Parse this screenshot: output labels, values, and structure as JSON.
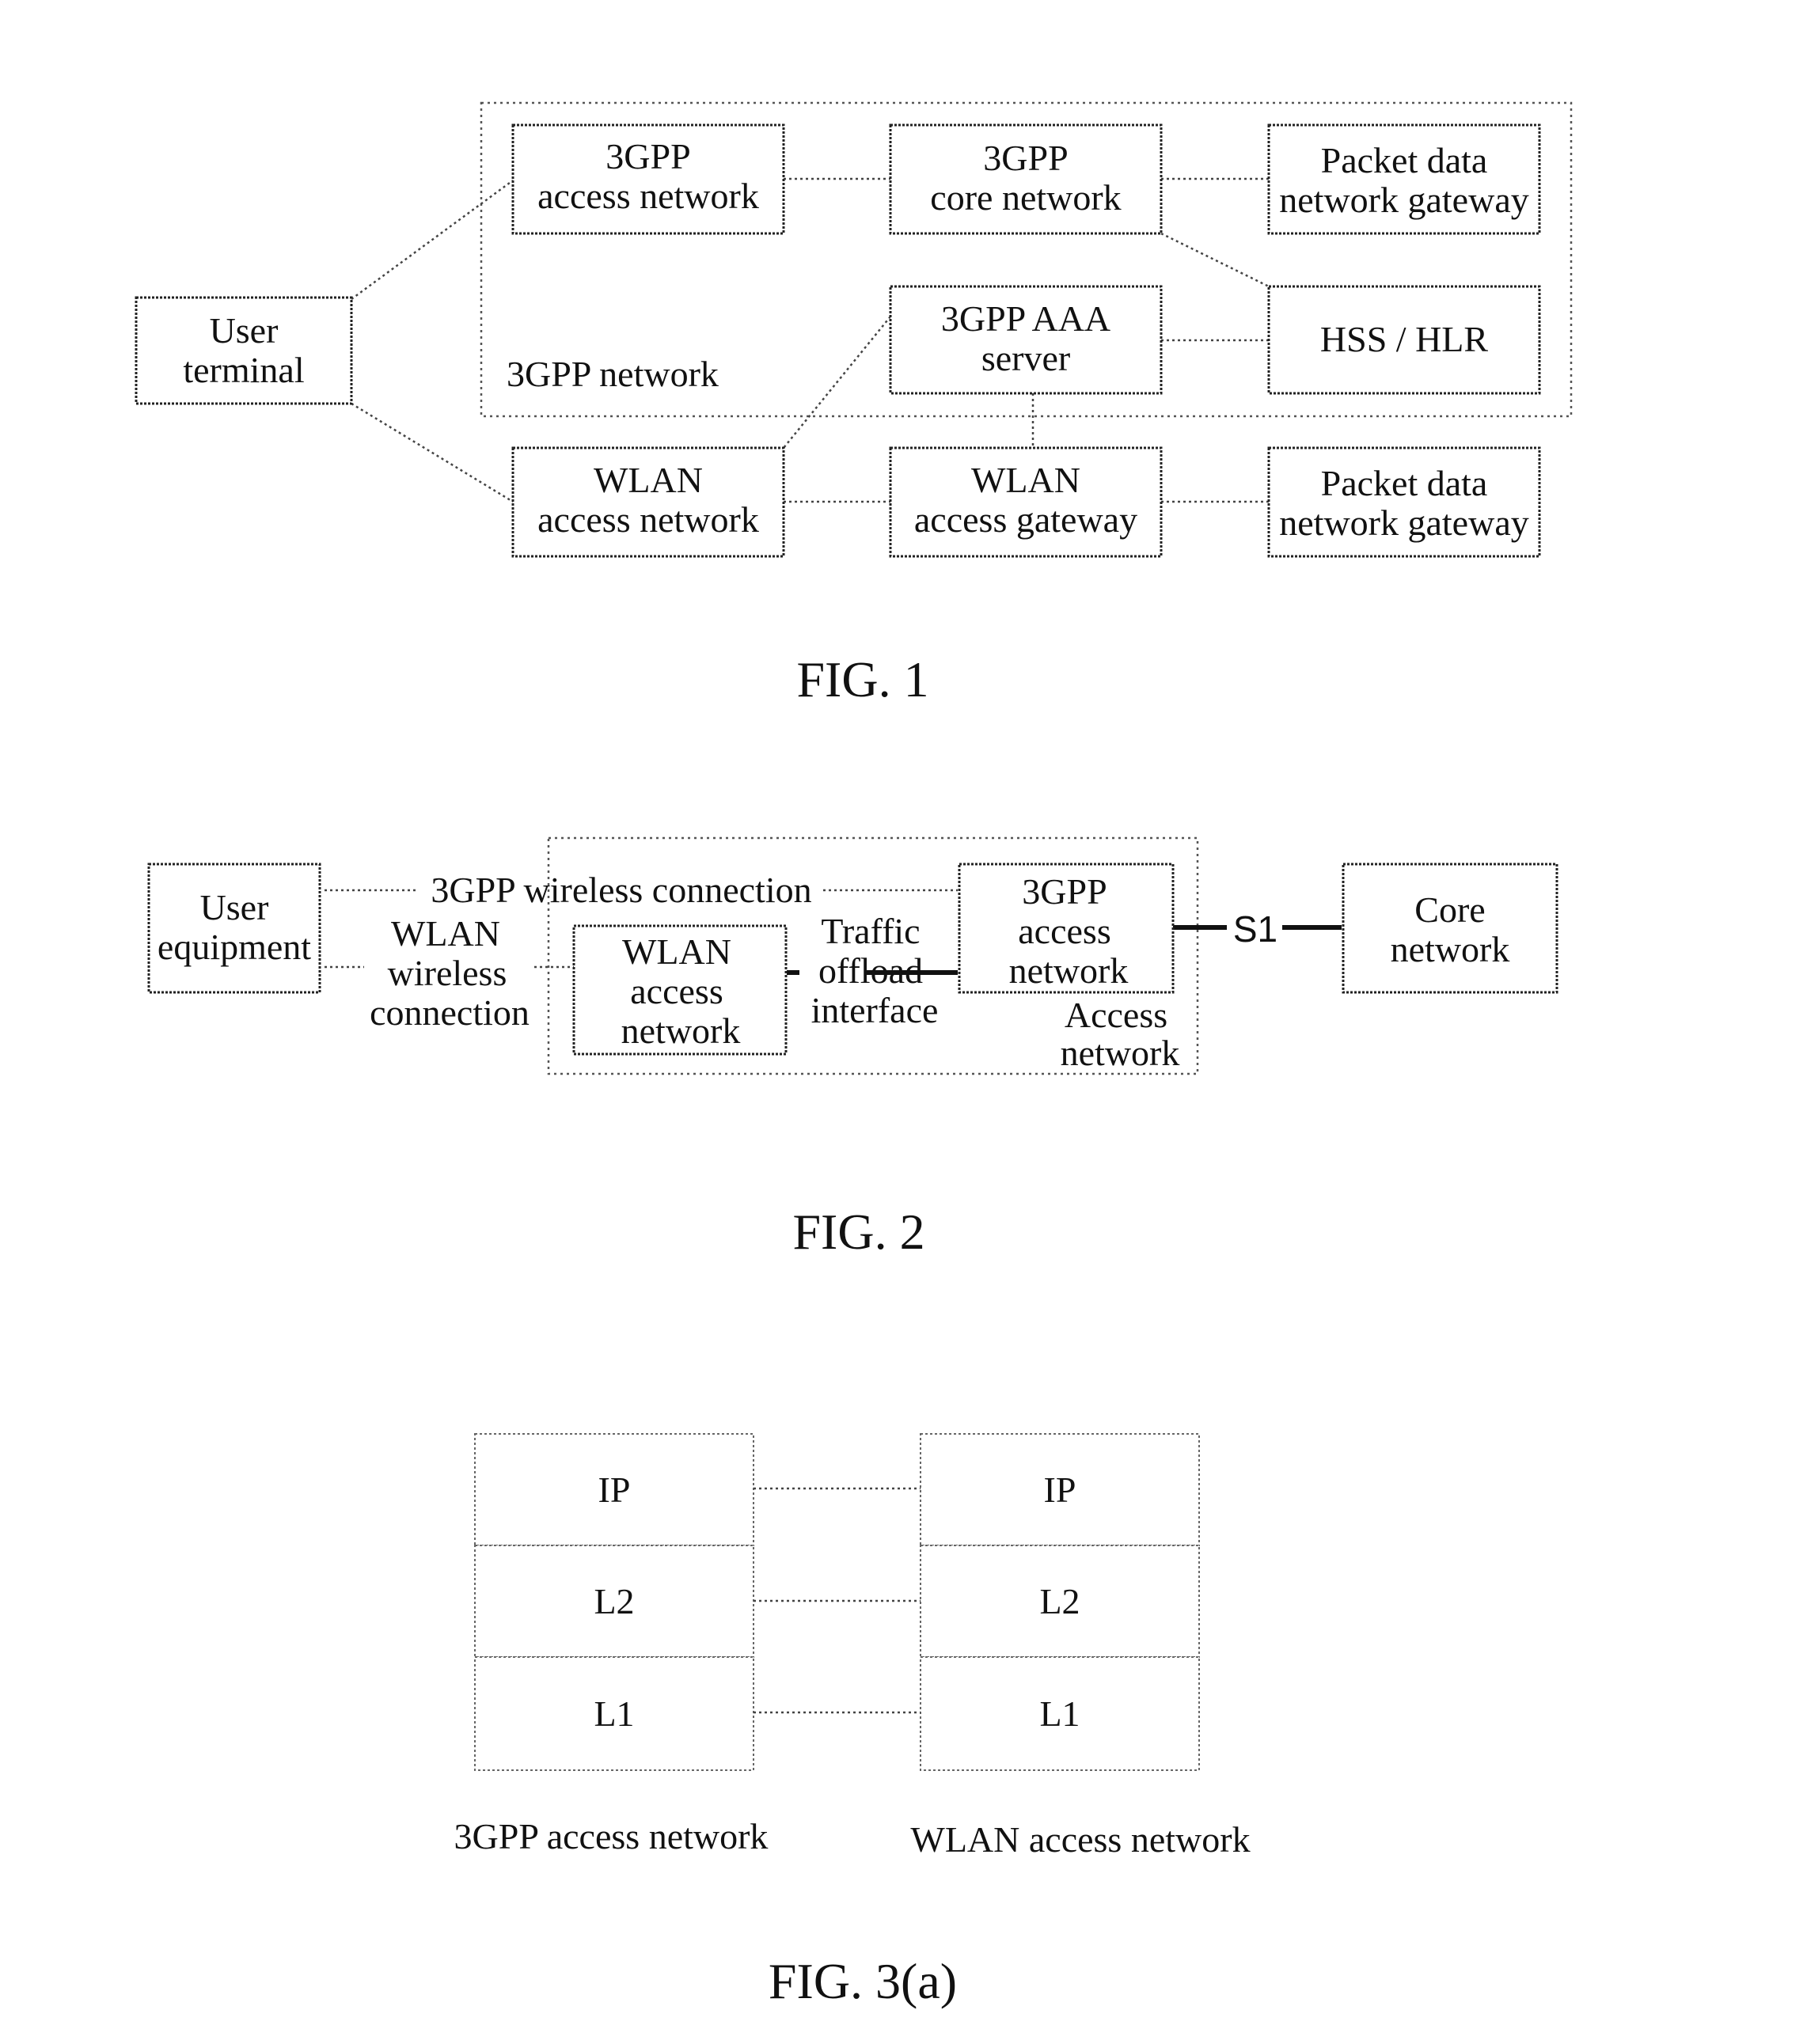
{
  "fig1": {
    "caption": "FIG. 1",
    "container_label": "3GPP network",
    "nodes": {
      "user_terminal": [
        "User",
        "terminal"
      ],
      "gpp_access": [
        "3GPP",
        "access network"
      ],
      "gpp_core": [
        "3GPP",
        "core network"
      ],
      "pdn_gw_top": [
        "Packet data",
        "network gateway"
      ],
      "aaa_server": [
        "3GPP AAA",
        "server"
      ],
      "hss_hlr": [
        "HSS / HLR"
      ],
      "wlan_access": [
        "WLAN",
        "access network"
      ],
      "wlan_gw": [
        "WLAN",
        "access gateway"
      ],
      "pdn_gw_bottom": [
        "Packet data",
        "network gateway"
      ]
    }
  },
  "fig2": {
    "caption": "FIG. 2",
    "container_label": [
      "Access",
      "network"
    ],
    "nodes": {
      "user_equipment": [
        "User",
        "equipment"
      ],
      "wlan_access": [
        "WLAN",
        "access",
        "network"
      ],
      "gpp_access": [
        "3GPP",
        "access",
        "network"
      ],
      "core_network": [
        "Core",
        "network"
      ]
    },
    "links": {
      "gpp_wireless": "3GPP wireless connection",
      "wlan_wireless": [
        "WLAN",
        "wireless",
        "connection"
      ],
      "traffic_offload": [
        "Traffic",
        "offload",
        "interface"
      ],
      "s1": "S1"
    }
  },
  "fig3a": {
    "caption": "FIG. 3(a)",
    "left_stack": {
      "label": "3GPP access network",
      "layers": [
        "IP",
        "L2",
        "L1"
      ]
    },
    "right_stack": {
      "label": "WLAN access network",
      "layers": [
        "IP",
        "L2",
        "L1"
      ]
    }
  }
}
